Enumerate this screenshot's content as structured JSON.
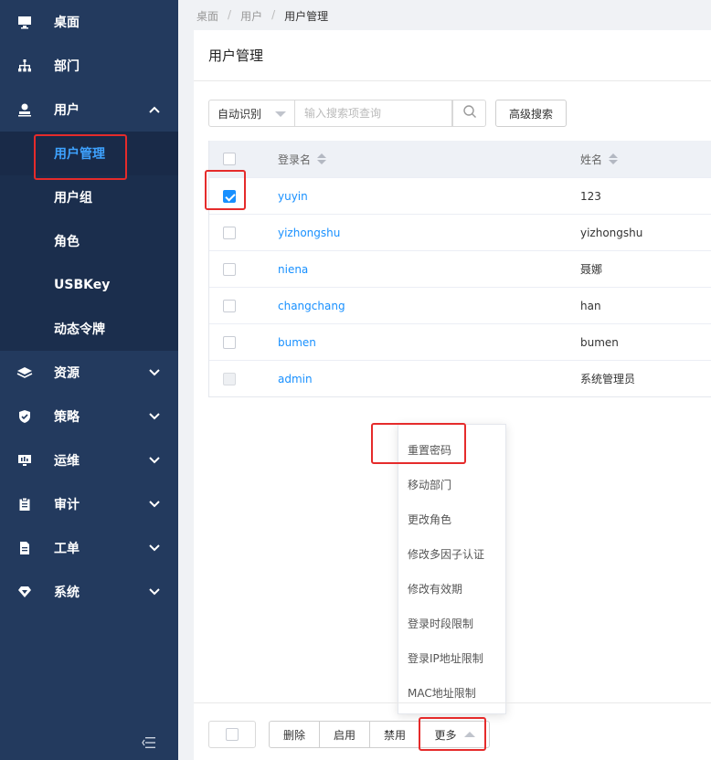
{
  "sidebar": {
    "items": [
      {
        "label": "桌面",
        "icon": "monitor-icon"
      },
      {
        "label": "部门",
        "icon": "org-chart-icon"
      },
      {
        "label": "用户",
        "icon": "user-icon",
        "expanded": true
      },
      {
        "label": "资源",
        "icon": "layers-icon"
      },
      {
        "label": "策略",
        "icon": "shield-icon"
      },
      {
        "label": "运维",
        "icon": "ops-monitor-icon"
      },
      {
        "label": "审计",
        "icon": "clipboard-icon"
      },
      {
        "label": "工单",
        "icon": "document-icon"
      },
      {
        "label": "系统",
        "icon": "gem-icon"
      }
    ],
    "user_submenu": [
      "用户管理",
      "用户组",
      "角色",
      "USBKey",
      "动态令牌"
    ],
    "active_submenu": "用户管理"
  },
  "breadcrumb": [
    "桌面",
    "用户",
    "用户管理"
  ],
  "page": {
    "title": "用户管理"
  },
  "search": {
    "mode": "自动识别",
    "placeholder": "输入搜索项查询",
    "value": "",
    "advanced_label": "高级搜索"
  },
  "table": {
    "columns": [
      "登录名",
      "姓名"
    ],
    "rows": [
      {
        "login": "yuyin",
        "name": "123",
        "checked": true,
        "disabled": false
      },
      {
        "login": "yizhongshu",
        "name": "yizhongshu",
        "checked": false,
        "disabled": false
      },
      {
        "login": "niena",
        "name": "聂娜",
        "checked": false,
        "disabled": false
      },
      {
        "login": "changchang",
        "name": "han",
        "checked": false,
        "disabled": false
      },
      {
        "login": "bumen",
        "name": "bumen",
        "checked": false,
        "disabled": false
      },
      {
        "login": "admin",
        "name": "系统管理员",
        "checked": false,
        "disabled": true
      }
    ]
  },
  "more_menu": [
    "重置密码",
    "移动部门",
    "更改角色",
    "修改多因子认证",
    "修改有效期",
    "登录时段限制",
    "登录IP地址限制",
    "MAC地址限制"
  ],
  "footer": {
    "delete_label": "删除",
    "enable_label": "启用",
    "disable_label": "禁用",
    "more_label": "更多"
  },
  "colors": {
    "sidebar_bg": "#233a5e",
    "active_blue": "#3ea2ff",
    "link_blue": "#1890ff",
    "highlight_red": "#e52b2b"
  }
}
